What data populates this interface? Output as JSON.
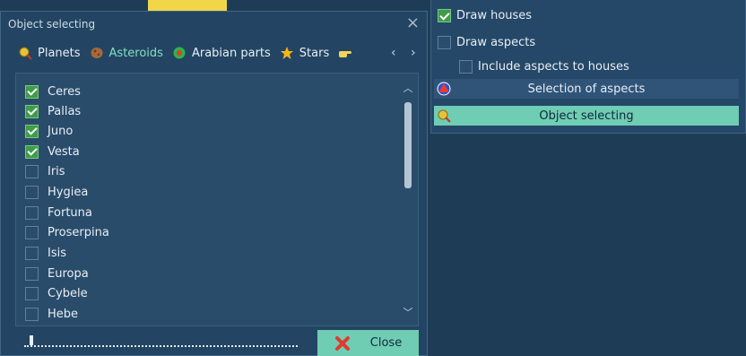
{
  "dialog": {
    "title": "Object selecting",
    "tabs": [
      {
        "label": "Planets",
        "icon": "planet-icon"
      },
      {
        "label": "Asteroids",
        "icon": "asteroid-icon",
        "active": true
      },
      {
        "label": "Arabian parts",
        "icon": "arabian-parts-icon"
      },
      {
        "label": "Stars",
        "icon": "star-icon"
      }
    ],
    "items": [
      {
        "label": "Ceres",
        "checked": true
      },
      {
        "label": "Pallas",
        "checked": true
      },
      {
        "label": "Juno",
        "checked": true
      },
      {
        "label": "Vesta",
        "checked": true
      },
      {
        "label": "Iris",
        "checked": false
      },
      {
        "label": "Hygiea",
        "checked": false
      },
      {
        "label": "Fortuna",
        "checked": false
      },
      {
        "label": "Proserpina",
        "checked": false
      },
      {
        "label": "Isis",
        "checked": false
      },
      {
        "label": "Europa",
        "checked": false
      },
      {
        "label": "Cybele",
        "checked": false
      },
      {
        "label": "Hebe",
        "checked": false
      }
    ],
    "close_label": "Close"
  },
  "right_panel": {
    "draw_houses": {
      "label": "Draw houses",
      "checked": true
    },
    "draw_aspects": {
      "label": "Draw aspects",
      "checked": false
    },
    "include_aspects_houses": {
      "label": "Include aspects to houses",
      "checked": false
    },
    "selection_of_aspects": "Selection of aspects",
    "object_selecting": "Object selecting"
  },
  "colors": {
    "background": "#1f3c57",
    "accent": "#6fcdb3",
    "active_tab": "#7fe0c3"
  }
}
